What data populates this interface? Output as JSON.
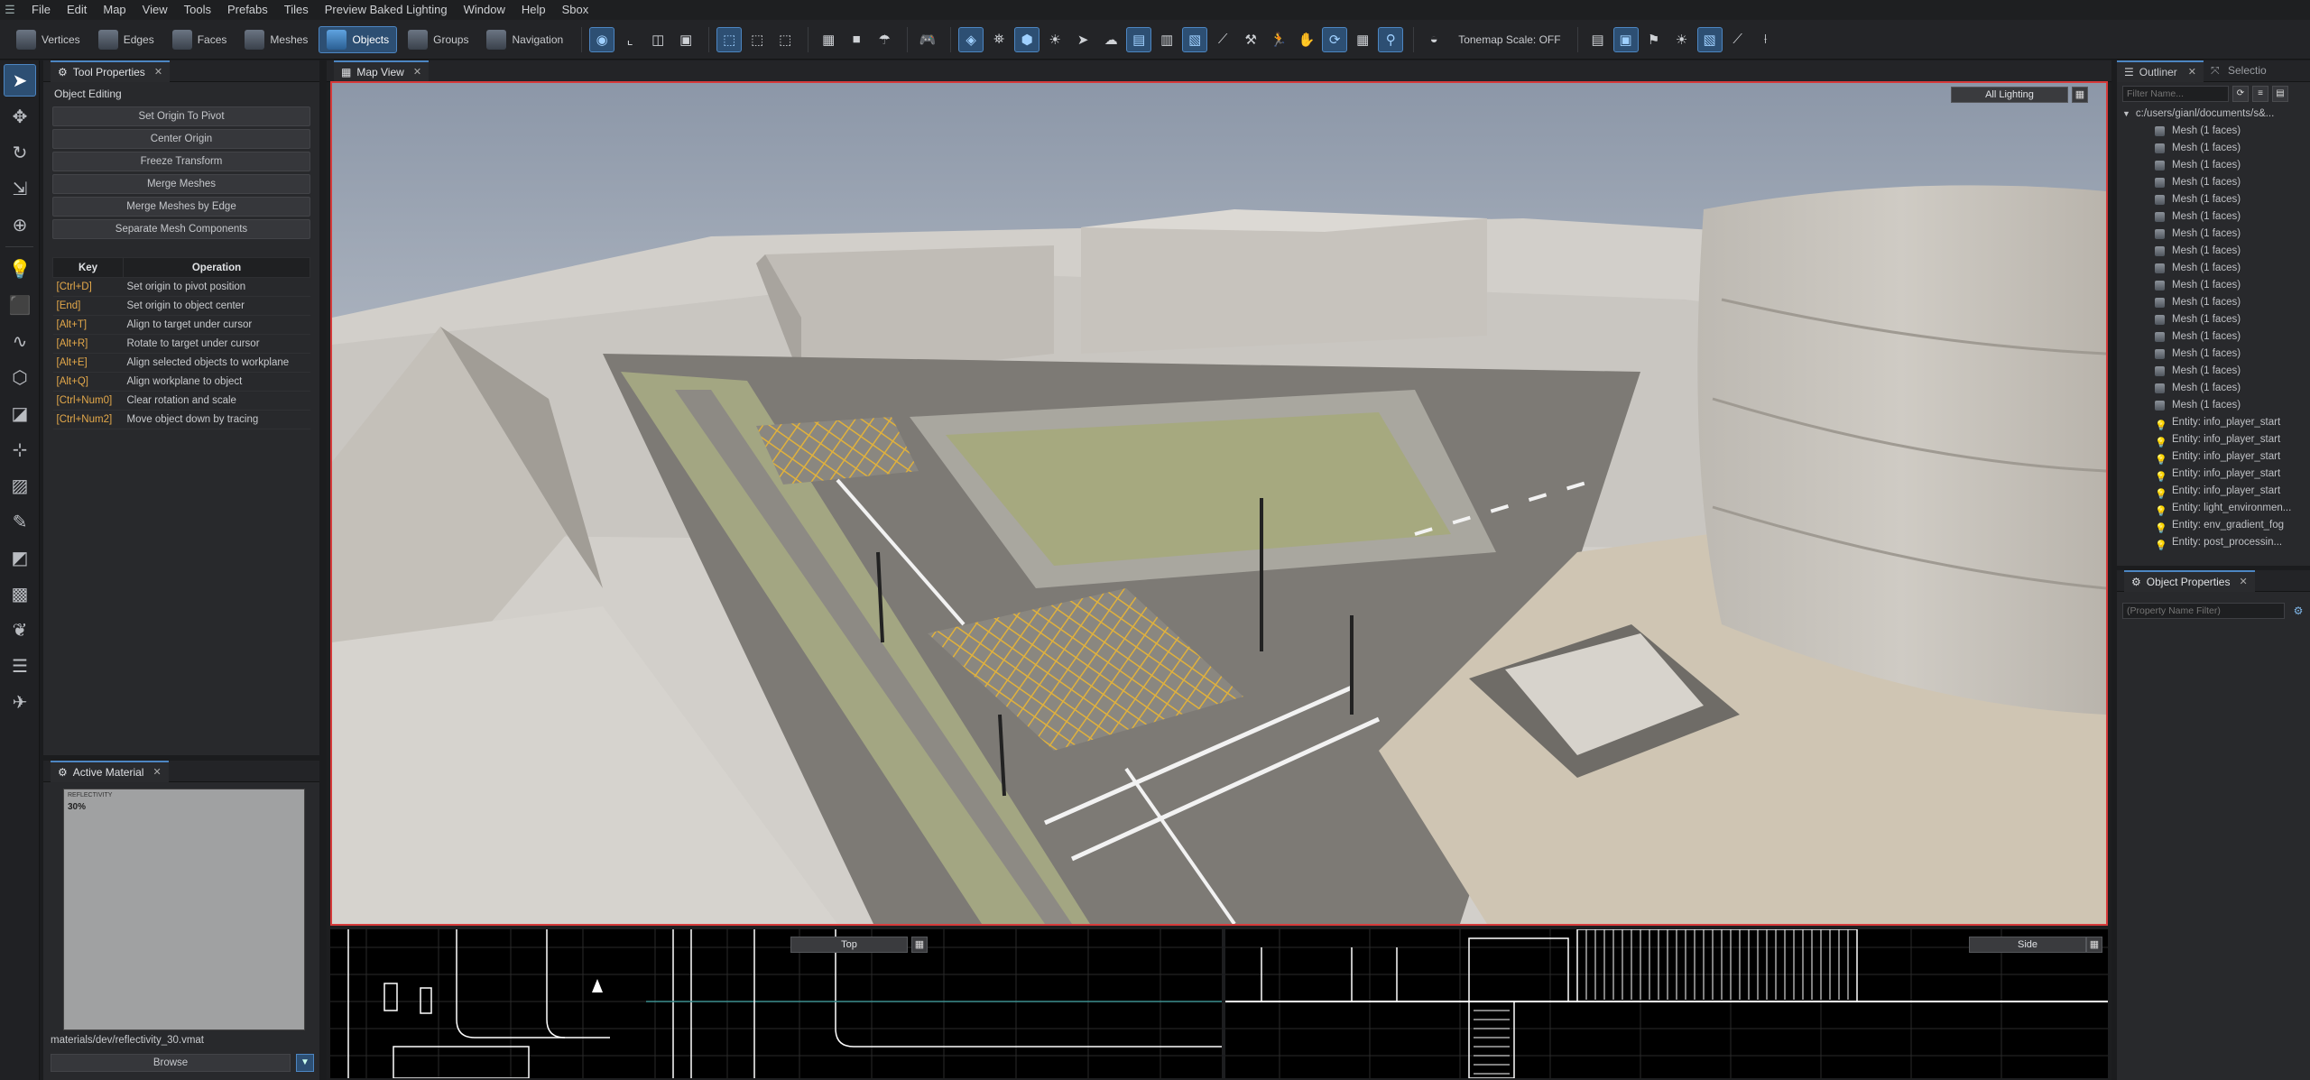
{
  "menubar": {
    "items": [
      "File",
      "Edit",
      "Map",
      "View",
      "Tools",
      "Prefabs",
      "Tiles",
      "Preview Baked Lighting",
      "Window",
      "Help",
      "Sbox"
    ]
  },
  "toolbar": {
    "modes": [
      {
        "label": "Vertices",
        "active": false
      },
      {
        "label": "Edges",
        "active": false
      },
      {
        "label": "Faces",
        "active": false
      },
      {
        "label": "Meshes",
        "active": false
      },
      {
        "label": "Objects",
        "active": true
      },
      {
        "label": "Groups",
        "active": false
      },
      {
        "label": "Navigation",
        "active": false
      }
    ],
    "tonemap_label": "Tonemap Scale: OFF",
    "accent": "#4d86c2"
  },
  "tool_properties": {
    "tab": "Tool Properties",
    "section": "Object Editing",
    "buttons": [
      "Set Origin To Pivot",
      "Center Origin",
      "Freeze Transform",
      "Merge Meshes",
      "Merge Meshes by Edge",
      "Separate Mesh Components"
    ],
    "table_headers": {
      "key": "Key",
      "operation": "Operation"
    },
    "shortcuts": [
      {
        "key": "[Ctrl+D]",
        "op": "Set origin to pivot position"
      },
      {
        "key": "[End]",
        "op": "Set origin to object center"
      },
      {
        "key": "[Alt+T]",
        "op": "Align to target under cursor"
      },
      {
        "key": "[Alt+R]",
        "op": "Rotate to target under cursor"
      },
      {
        "key": "[Alt+E]",
        "op": "Align selected objects to workplane"
      },
      {
        "key": "[Alt+Q]",
        "op": "Align workplane to object"
      },
      {
        "key": "[Ctrl+Num0]",
        "op": "Clear rotation and scale"
      },
      {
        "key": "[Ctrl+Num2]",
        "op": "Move object down by tracing"
      }
    ]
  },
  "active_material": {
    "tab": "Active Material",
    "preview_title": "REFLECTIVITY",
    "preview_value": "30%",
    "path": "materials/dev/reflectivity_30.vmat",
    "browse_label": "Browse"
  },
  "map_view": {
    "tab": "Map View",
    "lighting_mode": "All Lighting",
    "ortho_top_label": "Top",
    "ortho_side_label": "Side",
    "selection_color": "#d63a3a"
  },
  "outliner": {
    "tab": "Outliner",
    "tab2": "Selectio",
    "filter_placeholder": "Filter Name...",
    "root": "c:/users/gianl/documents/s&...",
    "items": [
      {
        "label": "Mesh (1 faces)",
        "type": "mesh"
      },
      {
        "label": "Mesh (1 faces)",
        "type": "mesh"
      },
      {
        "label": "Mesh (1 faces)",
        "type": "mesh"
      },
      {
        "label": "Mesh (1 faces)",
        "type": "mesh"
      },
      {
        "label": "Mesh (1 faces)",
        "type": "mesh"
      },
      {
        "label": "Mesh (1 faces)",
        "type": "mesh"
      },
      {
        "label": "Mesh (1 faces)",
        "type": "mesh"
      },
      {
        "label": "Mesh (1 faces)",
        "type": "mesh"
      },
      {
        "label": "Mesh (1 faces)",
        "type": "mesh"
      },
      {
        "label": "Mesh (1 faces)",
        "type": "mesh"
      },
      {
        "label": "Mesh (1 faces)",
        "type": "mesh"
      },
      {
        "label": "Mesh (1 faces)",
        "type": "mesh"
      },
      {
        "label": "Mesh (1 faces)",
        "type": "mesh"
      },
      {
        "label": "Mesh (1 faces)",
        "type": "mesh"
      },
      {
        "label": "Mesh (1 faces)",
        "type": "mesh"
      },
      {
        "label": "Mesh (1 faces)",
        "type": "mesh"
      },
      {
        "label": "Mesh (1 faces)",
        "type": "mesh"
      },
      {
        "label": "Entity: info_player_start",
        "type": "entity"
      },
      {
        "label": "Entity: info_player_start",
        "type": "entity"
      },
      {
        "label": "Entity: info_player_start",
        "type": "entity"
      },
      {
        "label": "Entity: info_player_start",
        "type": "entity"
      },
      {
        "label": "Entity: info_player_start",
        "type": "entity"
      },
      {
        "label": "Entity: light_environmen...",
        "type": "entity"
      },
      {
        "label": "Entity: env_gradient_fog",
        "type": "entity"
      },
      {
        "label": "Entity: post_processin...",
        "type": "entity"
      }
    ]
  },
  "object_properties": {
    "tab": "Object Properties",
    "filter_placeholder": "(Property Name Filter)"
  }
}
